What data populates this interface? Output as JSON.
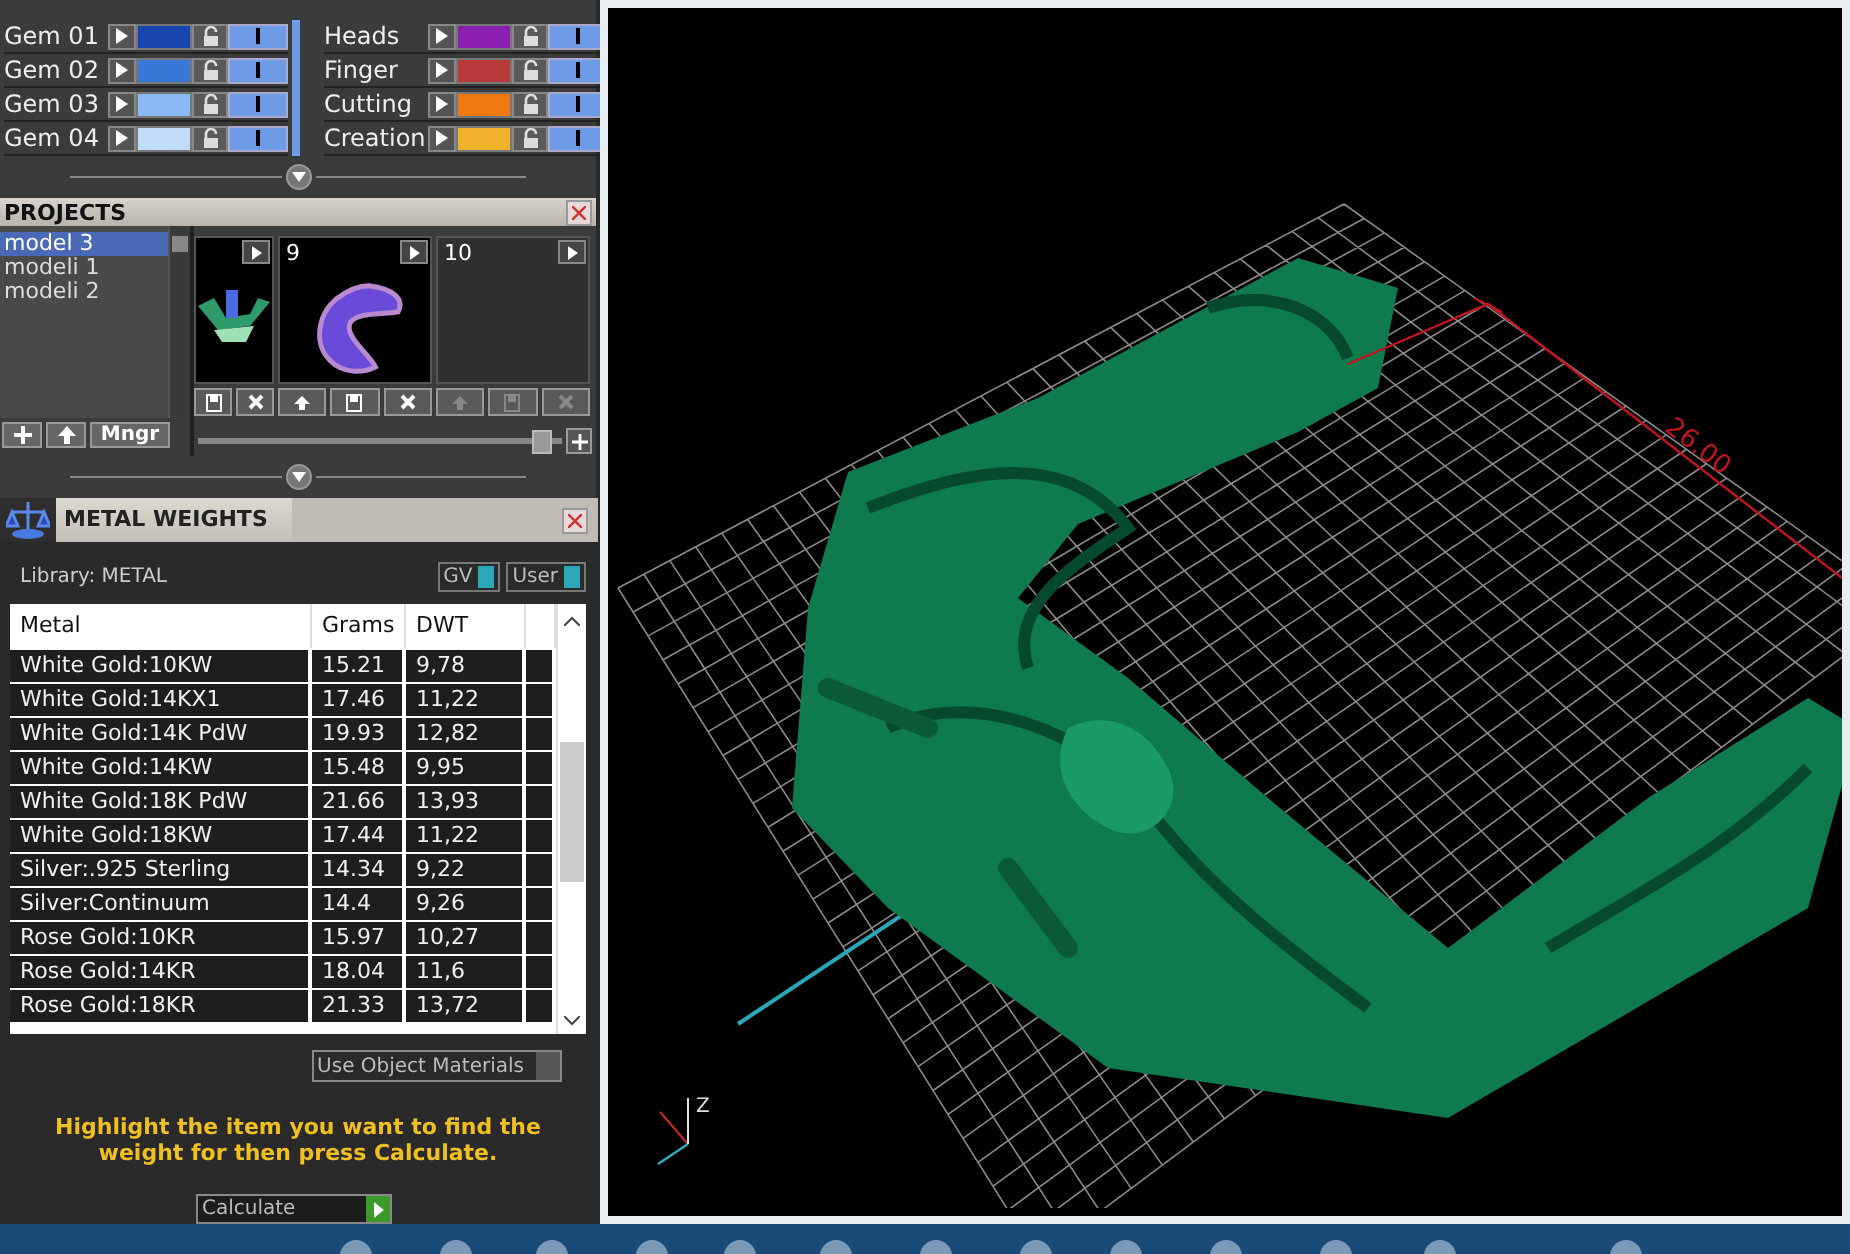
{
  "materials": {
    "columns": [
      [
        {
          "name": "Gem 01",
          "color": "#1845b0",
          "visible": true
        },
        {
          "name": "Gem 02",
          "color": "#3a78d8",
          "visible": true
        },
        {
          "name": "Gem 03",
          "color": "#8ab8f5",
          "visible": true
        },
        {
          "name": "Gem 04",
          "color": "#c4dcfb",
          "visible": true
        }
      ],
      [
        {
          "name": "Heads",
          "color": "#8a1fb0",
          "visible": true
        },
        {
          "name": "Finger",
          "color": "#b83a3a",
          "visible": true
        },
        {
          "name": "Cutting",
          "color": "#f07a10",
          "visible": true
        },
        {
          "name": "Creation",
          "color": "#f0b22a",
          "visible": true
        }
      ]
    ]
  },
  "projects": {
    "title": "PROJECTS",
    "list": [
      {
        "label": "model 3",
        "selected": true
      },
      {
        "label": "modeli 1",
        "selected": false
      },
      {
        "label": "modeli 2",
        "selected": false
      }
    ],
    "manager_button": "Mngr",
    "zoom": {
      "level": 0.97
    },
    "thumbnails": [
      {
        "kind": "clip",
        "disabled": false
      },
      {
        "kind": "model",
        "number": "9",
        "disabled": false
      },
      {
        "kind": "empty",
        "number": "10",
        "disabled": true
      }
    ]
  },
  "metal_weights": {
    "title": "METAL WEIGHTS",
    "library": "Library: METAL",
    "toggles": [
      {
        "label": "GV",
        "on": true
      },
      {
        "label": "User",
        "on": true
      }
    ],
    "columns": [
      "Metal",
      "Grams",
      "DWT"
    ],
    "rows": [
      [
        "White Gold:10KW",
        "15.21",
        "9,78"
      ],
      [
        "White Gold:14KX1",
        "17.46",
        "11,22"
      ],
      [
        "White Gold:14K PdW",
        "19.93",
        "12,82"
      ],
      [
        "White Gold:14KW",
        "15.48",
        "9,95"
      ],
      [
        "White Gold:18K PdW",
        "21.66",
        "13,93"
      ],
      [
        "White Gold:18KW",
        "17.44",
        "11,22"
      ],
      [
        "Silver:.925 Sterling",
        "14.34",
        "9,22"
      ],
      [
        "Silver:Continuum",
        "14.4",
        "9,26"
      ],
      [
        "Rose Gold:10KR",
        "15.97",
        "10,27"
      ],
      [
        "Rose Gold:14KR",
        "18.04",
        "11,6"
      ],
      [
        "Rose Gold:18KR",
        "21.33",
        "13,72"
      ]
    ],
    "use_object_materials": {
      "label": "Use Object Materials",
      "checked": false
    },
    "hint": "Highlight the item you want to find the weight for then press Calculate.",
    "calculate": "Calculate"
  },
  "viewport": {
    "dimension": "26.00",
    "axis_label": "Z"
  }
}
